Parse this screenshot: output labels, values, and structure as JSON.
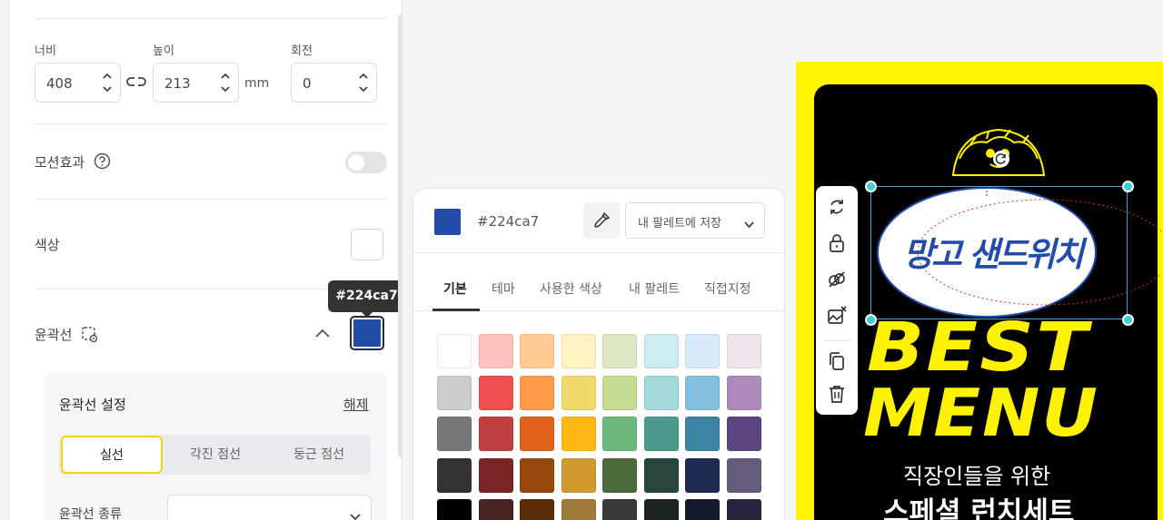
{
  "properties": {
    "width_label": "너비",
    "width_value": "408",
    "height_label": "높이",
    "height_value": "213",
    "unit": "mm",
    "rotation_label": "회전",
    "rotation_value": "0",
    "motion_label": "모션효과",
    "motion_enabled": false,
    "color_label": "색상",
    "stroke_label": "윤곽선",
    "stroke_color": "#224ca7",
    "stroke_tooltip": "#224ca7",
    "stroke_settings_title": "윤곽선 설정",
    "stroke_remove": "해제",
    "stroke_styles": [
      "실선",
      "각진 점선",
      "둥근 점선"
    ],
    "stroke_type_label": "윤곽선 종류"
  },
  "picker": {
    "current_hex": "#224ca7",
    "save_palette": "내 팔레트에 저장",
    "tabs": [
      "기본",
      "테마",
      "사용한 색상",
      "내 팔레트",
      "직접지정"
    ],
    "active_tab": "기본",
    "swatches": [
      [
        "#ffffff",
        "#ffc0c0",
        "#ffcb94",
        "#fff3c2",
        "#dfe8c5",
        "#cdedf0",
        "#d8eaf8",
        "#efe3ee"
      ],
      [
        "#cccccc",
        "#ef4f4f",
        "#ff9a4a",
        "#f2d96b",
        "#c6dc93",
        "#a3dad9",
        "#83bfde",
        "#ad8ab9"
      ],
      [
        "#777777",
        "#c13f3f",
        "#e0631c",
        "#ffb814",
        "#6cb87c",
        "#4d9a8d",
        "#3e82a4",
        "#5c4682"
      ],
      [
        "#333333",
        "#7b2424",
        "#98480c",
        "#cf9b2e",
        "#4c6a3b",
        "#27463e",
        "#1f2a52",
        "#645c7a"
      ],
      [
        "#000000",
        "#4a2323",
        "#5a2e08",
        "#a07a3a",
        "#3a3a3a",
        "#1c2424",
        "#15192c",
        "#2a2340"
      ]
    ]
  },
  "canvas": {
    "poster_bg": "#fff500",
    "logo_text": "망고 샌드위치",
    "best": "BEST",
    "menu": "MENU",
    "sub1": "직장인들을 위한",
    "sub2": "스페셜 런치세트"
  },
  "toolbar": {
    "icons": [
      "rotate-icon",
      "lock-icon",
      "unlink-icon",
      "replace-image-icon",
      "duplicate-icon",
      "delete-icon"
    ]
  }
}
